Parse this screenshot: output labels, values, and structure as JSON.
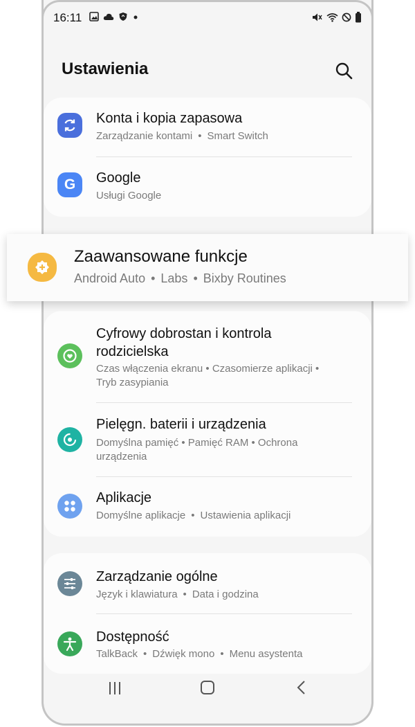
{
  "status": {
    "time": "16:11",
    "left_icons": [
      "image-icon",
      "cloud-icon",
      "shield-icon",
      "dot-icon"
    ],
    "right_icons": [
      "mute-icon",
      "wifi-icon",
      "dnd-icon",
      "battery-icon"
    ]
  },
  "header": {
    "title": "Ustawienia",
    "search_icon": "search-icon"
  },
  "items": [
    {
      "title": "Konta i kopia zapasowa",
      "sub": [
        "Zarządzanie kontami",
        "Smart Switch"
      ],
      "icon": "sync-icon",
      "color": "#4a6fdc"
    },
    {
      "title": "Google",
      "sub": [
        "Usługi Google"
      ],
      "icon": "google-icon",
      "color": "#4b86f5"
    },
    {
      "title": "Zaawansowane funkcje",
      "sub": [
        "Android Auto",
        "Labs",
        "Bixby Routines"
      ],
      "icon": "advanced-features-icon",
      "color": "#f5b942"
    },
    {
      "title1": "Cyfrowy dobrostan i kontrola",
      "title2": "rodzicielska",
      "sub1": "Czas włączenia ekranu • Czasomierze aplikacji •",
      "sub2": "Tryb zasypiania",
      "icon": "wellbeing-icon",
      "color": "#5cc05c"
    },
    {
      "title": "Pielęgn. baterii i urządzenia",
      "sub1": "Domyślna pamięć • Pamięć RAM • Ochrona",
      "sub2": "urządzenia",
      "icon": "device-care-icon",
      "color": "#1fb3a3"
    },
    {
      "title": "Aplikacje",
      "sub": [
        "Domyślne aplikacje",
        "Ustawienia aplikacji"
      ],
      "icon": "apps-icon",
      "color": "#6fa2ef"
    },
    {
      "title": "Zarządzanie ogólne",
      "sub": [
        "Język i klawiatura",
        "Data i godzina"
      ],
      "icon": "general-management-icon",
      "color": "#6b8797"
    },
    {
      "title": "Dostępność",
      "sub": [
        "TalkBack",
        "Dźwięk mono",
        "Menu asystenta"
      ],
      "icon": "accessibility-icon",
      "color": "#39a85a"
    }
  ],
  "nav": {
    "icons": [
      "recents-icon",
      "home-icon",
      "back-icon"
    ]
  }
}
